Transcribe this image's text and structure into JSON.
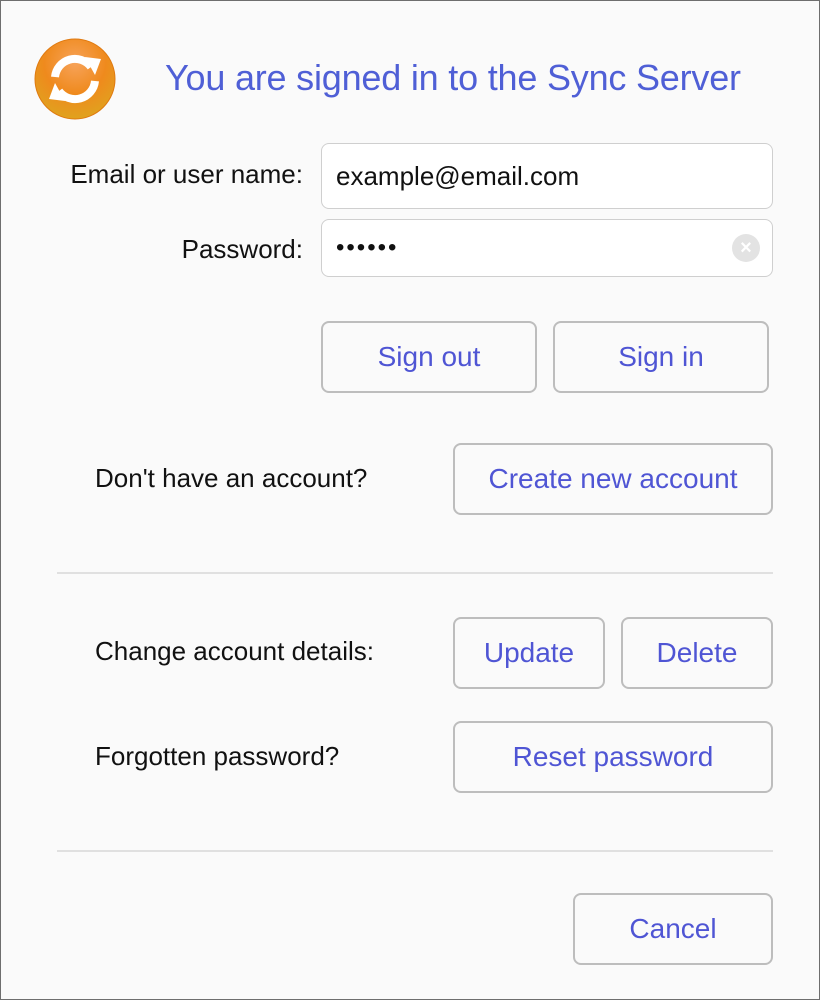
{
  "header": {
    "title": "You are signed in to the Sync Server",
    "logo_icon": "sync-icon"
  },
  "form": {
    "email_label": "Email or user name:",
    "email_value": "example@email.com",
    "password_label": "Password:",
    "password_value": "••••••",
    "password_clear_icon": "clear-icon"
  },
  "buttons": {
    "sign_out": "Sign out",
    "sign_in": "Sign in",
    "create_account": "Create new account",
    "update": "Update",
    "delete": "Delete",
    "reset_password": "Reset password",
    "cancel": "Cancel"
  },
  "labels": {
    "no_account": "Don't have an account?",
    "change_details": "Change account details:",
    "forgotten_password": "Forgotten password?"
  },
  "colors": {
    "accent": "#4f55d4",
    "title": "#4f5fd6",
    "logo": "#f08a1c"
  }
}
